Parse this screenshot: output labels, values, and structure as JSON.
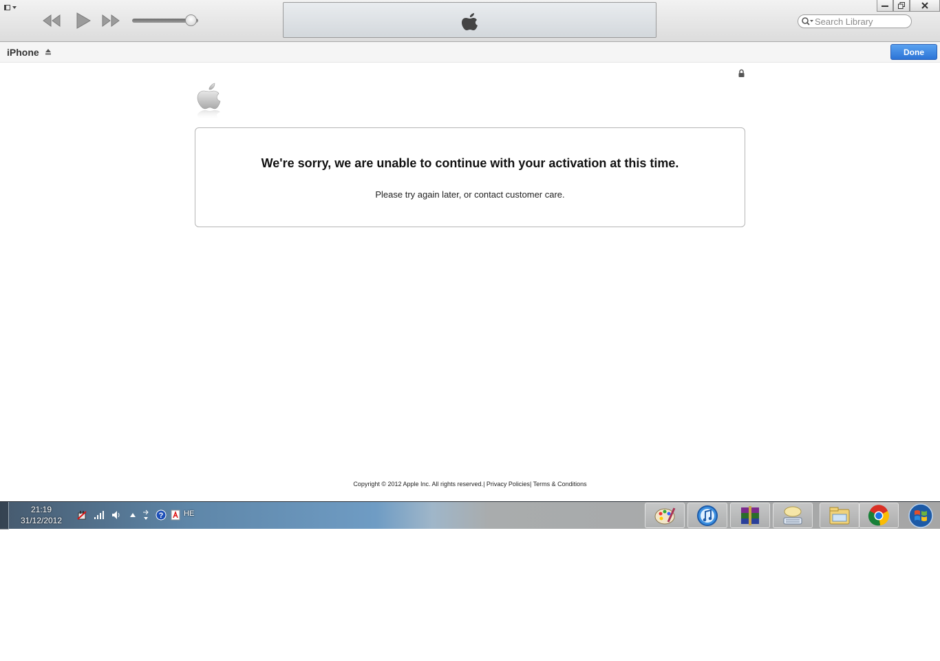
{
  "toolbar": {
    "search_placeholder": "Search Library",
    "volume_level": 0.9
  },
  "device_bar": {
    "device_name": "iPhone",
    "done_label": "Done"
  },
  "content": {
    "message_title": "We're sorry, we are unable to continue with your activation at this time.",
    "message_body": "Please try again later, or contact customer care.",
    "footer": {
      "copyright": "Copyright © 2012 Apple Inc. All rights reserved.",
      "sep1": "| ",
      "privacy": "Privacy Policies",
      "sep2": "| ",
      "terms": "Terms & Conditions"
    }
  },
  "taskbar": {
    "time": "21:19",
    "date": "31/12/2012",
    "language": "HE",
    "pinned_apps": [
      "paint-icon",
      "itunes-icon",
      "winrar-icon",
      "onscreen-keyboard-icon",
      "windows-explorer-icon",
      "chrome-icon"
    ]
  },
  "colors": {
    "done_button": "#2b73d6",
    "taskbar": "#5e86a8"
  }
}
